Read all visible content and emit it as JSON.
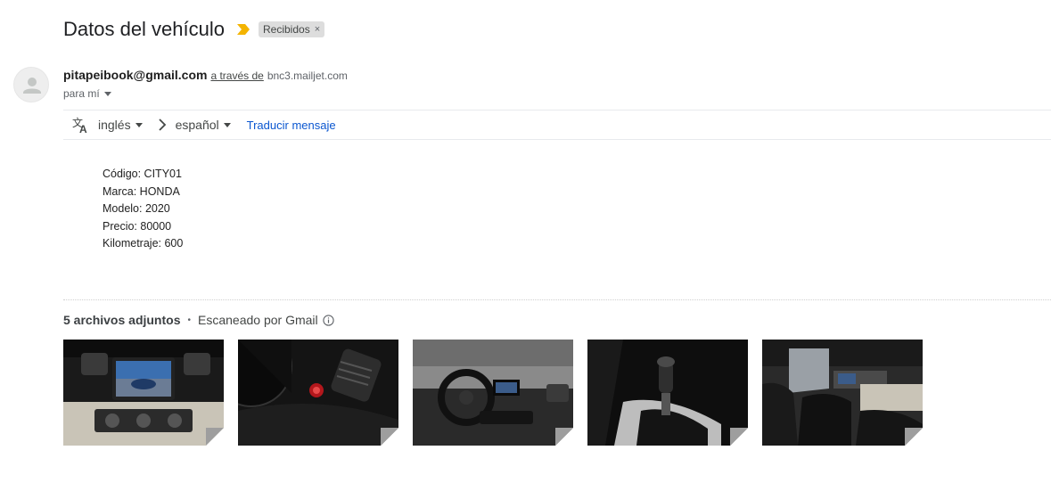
{
  "email": {
    "subject": "Datos del vehículo",
    "label": "Recibidos",
    "label_close": "×",
    "sender_email": "pitapeibook@gmail.com",
    "via_text": "a través de",
    "via_domain": "bnc3.mailjet.com",
    "recipient": "para mí"
  },
  "translate": {
    "source_lang": "inglés",
    "target_lang": "español",
    "action": "Traducir mensaje"
  },
  "body_lines": [
    "Código: CITY01",
    "Marca: HONDA",
    "Modelo: 2020",
    "Precio: 80000",
    "Kilometraje: 600"
  ],
  "attachments": {
    "count_label": "5 archivos adjuntos",
    "separator": "•",
    "scanned_label": "Escaneado por Gmail",
    "items": [
      {
        "kind": "dashboard-screen-thumbnail"
      },
      {
        "kind": "instrument-cluster-thumbnail"
      },
      {
        "kind": "steering-wheel-thumbnail"
      },
      {
        "kind": "gear-shifter-thumbnail"
      },
      {
        "kind": "seats-interior-thumbnail"
      }
    ]
  },
  "colors": {
    "importance": "#f4b400",
    "link": "#0b57d0",
    "chip_bg": "#dddddd"
  }
}
